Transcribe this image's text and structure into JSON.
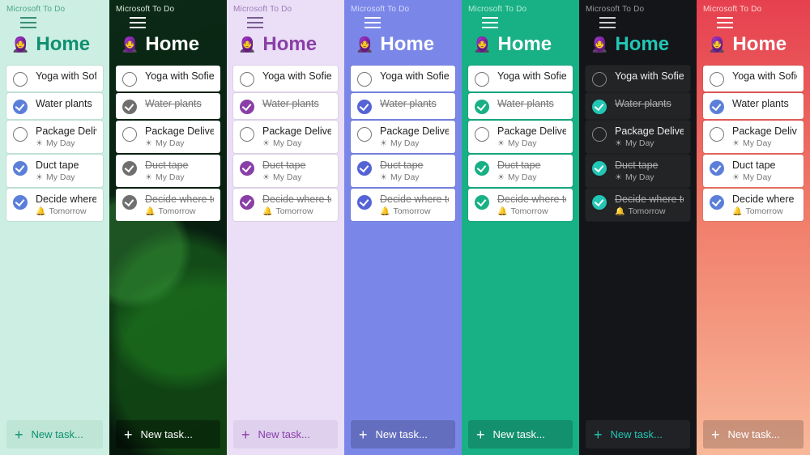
{
  "appTitle": "Microsoft To Do",
  "listTitle": "Home",
  "listEmoji": "🧕",
  "newTaskLabel": "New task...",
  "tasks": [
    {
      "label": "Yoga with Sofie",
      "done": false,
      "meta": null
    },
    {
      "label": "Water plants",
      "done": true,
      "meta": null
    },
    {
      "label": "Package Delivery",
      "done": false,
      "meta": {
        "icon": "sun",
        "text": "My Day"
      }
    },
    {
      "label": "Duct tape",
      "done": true,
      "meta": {
        "icon": "sun",
        "text": "My Day"
      }
    },
    {
      "label": "Decide where to go for the weekend",
      "done": true,
      "meta": {
        "icon": "bell",
        "text": "Tomorrow"
      }
    }
  ],
  "panels": [
    {
      "width": 135,
      "bg": "#cdeee2",
      "accent": "#0e8f70",
      "appTitleColor": "#4aa68c",
      "burgerColor": "#3a8f77",
      "titleColor": "#0e8f70",
      "doneColor": "#5b7fd9",
      "newBg": "#bfe5d6",
      "newColor": "#0e8f70",
      "cards": "light",
      "strikeDone": false
    },
    {
      "width": 145,
      "bg": "fern",
      "accent": "#ffffff",
      "appTitleColor": "#d8ead8",
      "burgerColor": "#ffffff",
      "titleColor": "#ffffff",
      "doneColor": "#6f6f6f",
      "newBg": "rgba(0,0,0,0.35)",
      "newColor": "#ffffff",
      "cards": "light",
      "strikeDone": true
    },
    {
      "width": 145,
      "bg": "#eadff6",
      "accent": "#8a3fa7",
      "appTitleColor": "#9d79b8",
      "burgerColor": "#7b5c94",
      "titleColor": "#8a3fa7",
      "doneColor": "#8a3fa7",
      "newBg": "#dfd0ee",
      "newColor": "#8a3fa7",
      "cards": "light",
      "strikeDone": true
    },
    {
      "width": 145,
      "bg": "#7b87e8",
      "accent": "#ffffff",
      "appTitleColor": "#d6dbff",
      "burgerColor": "#ffffff",
      "titleColor": "#ffffff",
      "doneColor": "#5563d6",
      "newBg": "rgba(0,0,0,0.18)",
      "newColor": "#ffffff",
      "cards": "light",
      "strikeDone": true
    },
    {
      "width": 145,
      "bg": "#18b085",
      "accent": "#ffffff",
      "appTitleColor": "#b6edd9",
      "burgerColor": "#ffffff",
      "titleColor": "#ffffff",
      "doneColor": "#18b085",
      "newBg": "rgba(0,0,0,0.18)",
      "newColor": "#ffffff",
      "cards": "light",
      "strikeDone": true
    },
    {
      "width": 145,
      "bg": "#141518",
      "accent": "#22c6b4",
      "appTitleColor": "#9a9a9a",
      "burgerColor": "#cfcfcf",
      "titleColor": "#22c6b4",
      "doneColor": "#22c6b4",
      "newBg": "rgba(255,255,255,0.06)",
      "newColor": "#22c6b4",
      "cards": "dark",
      "strikeDone": true
    },
    {
      "width": 140,
      "bg": "coral",
      "accent": "#ffffff",
      "appTitleColor": "#ffd5d5",
      "burgerColor": "#ffffff",
      "titleColor": "#ffffff",
      "doneColor": "#5b7fd9",
      "newBg": "rgba(0,0,0,0.18)",
      "newColor": "#ffffff",
      "cards": "light",
      "strikeDone": false
    }
  ]
}
